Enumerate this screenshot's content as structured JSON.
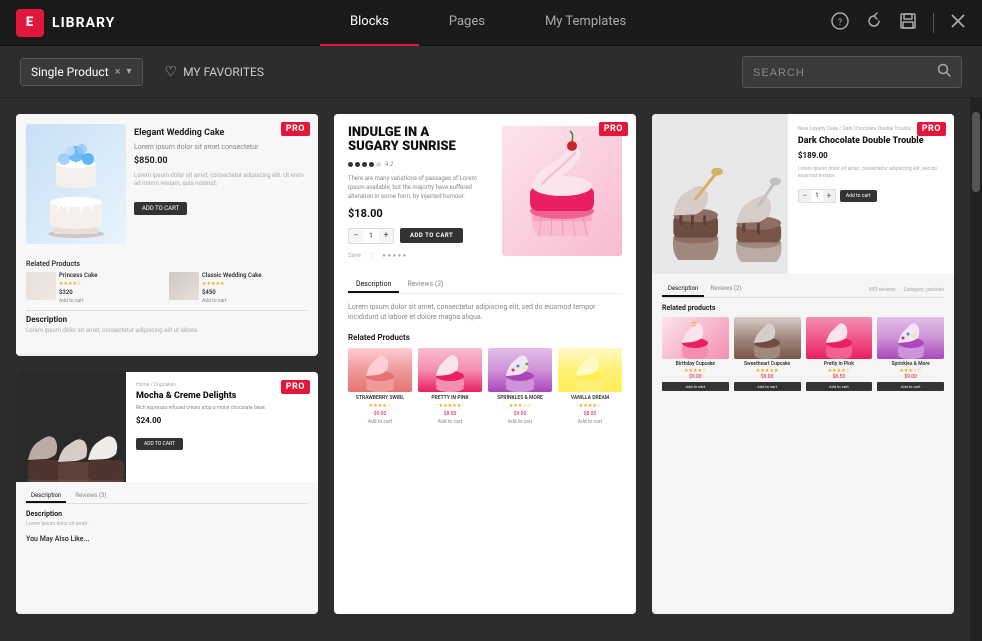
{
  "header": {
    "logo_text": "LIBRARY",
    "logo_icon": "E",
    "tabs": [
      {
        "id": "blocks",
        "label": "Blocks",
        "active": true
      },
      {
        "id": "pages",
        "label": "Pages",
        "active": false
      },
      {
        "id": "my-templates",
        "label": "My Templates",
        "active": false
      }
    ],
    "actions": {
      "help_icon": "?",
      "refresh_icon": "↻",
      "save_icon": "⬡",
      "close_icon": "✕"
    }
  },
  "toolbar": {
    "filter_label": "Single Product",
    "filter_x": "×",
    "favorites_label": "MY FAVORITES",
    "search_placeholder": "SEARCH"
  },
  "cards": [
    {
      "id": "card1",
      "badge": "PRO",
      "title": "Elegant Wedding Cake",
      "price": "$850.00",
      "button": "ADD TO CART",
      "description_title": "Description",
      "related_title": "Related Products",
      "related_items": [
        {
          "name": "Princess Cake",
          "price": "$320"
        },
        {
          "name": "Classic Wedding Cake",
          "price": "$450"
        }
      ]
    },
    {
      "id": "card2",
      "badge": "PRO",
      "subtitle": "INDULGE IN A",
      "title": "INDULGE IN A SUGARY SUNRISE",
      "price": "$18.00",
      "qty": "1",
      "add_to_cart": "ADD TO CART",
      "tabs": [
        "Description",
        "Reviews (2)"
      ],
      "related_title": "Related Products",
      "related_items": [
        {
          "name": "STRAWBERRY SWIRL",
          "price": "$9.00"
        },
        {
          "name": "PRETTY IN PINK",
          "price": "$8.50"
        },
        {
          "name": "SPRINKLES & MORE",
          "price": "$9.00"
        },
        {
          "name": "VANILLA DREAM",
          "price": "$8.00"
        }
      ]
    },
    {
      "id": "card3",
      "badge": "PRO",
      "breadcrumb": "Near Loyalty Cake / Dark Chocolate Double Trouble",
      "title": "Dark Chocolate Double Trouble",
      "price": "$189.00",
      "add_btn": "Add to cart",
      "tabs": [
        "Description",
        "Reviews (2)"
      ],
      "related_title": "Related products",
      "related_items": [
        {
          "name": "Birthday Cupcake",
          "price": "$9.00"
        },
        {
          "name": "Sweetheart Cupcake",
          "price": "$9.00"
        },
        {
          "name": "Pretty in Pink",
          "price": "$8.50"
        },
        {
          "name": "Sprinkles & More",
          "price": "$9.00"
        }
      ]
    },
    {
      "id": "card4",
      "badge": "PRO",
      "title": "Mocha & Creme Delights",
      "price": "$24.00",
      "button": "ADD TO CART",
      "tabs": [
        "Description",
        "Reviews (3)"
      ],
      "desc_title": "Description",
      "desc_text": "Lorem ipsum dolor sit amet.",
      "may_like": "You May Also Like..."
    }
  ]
}
